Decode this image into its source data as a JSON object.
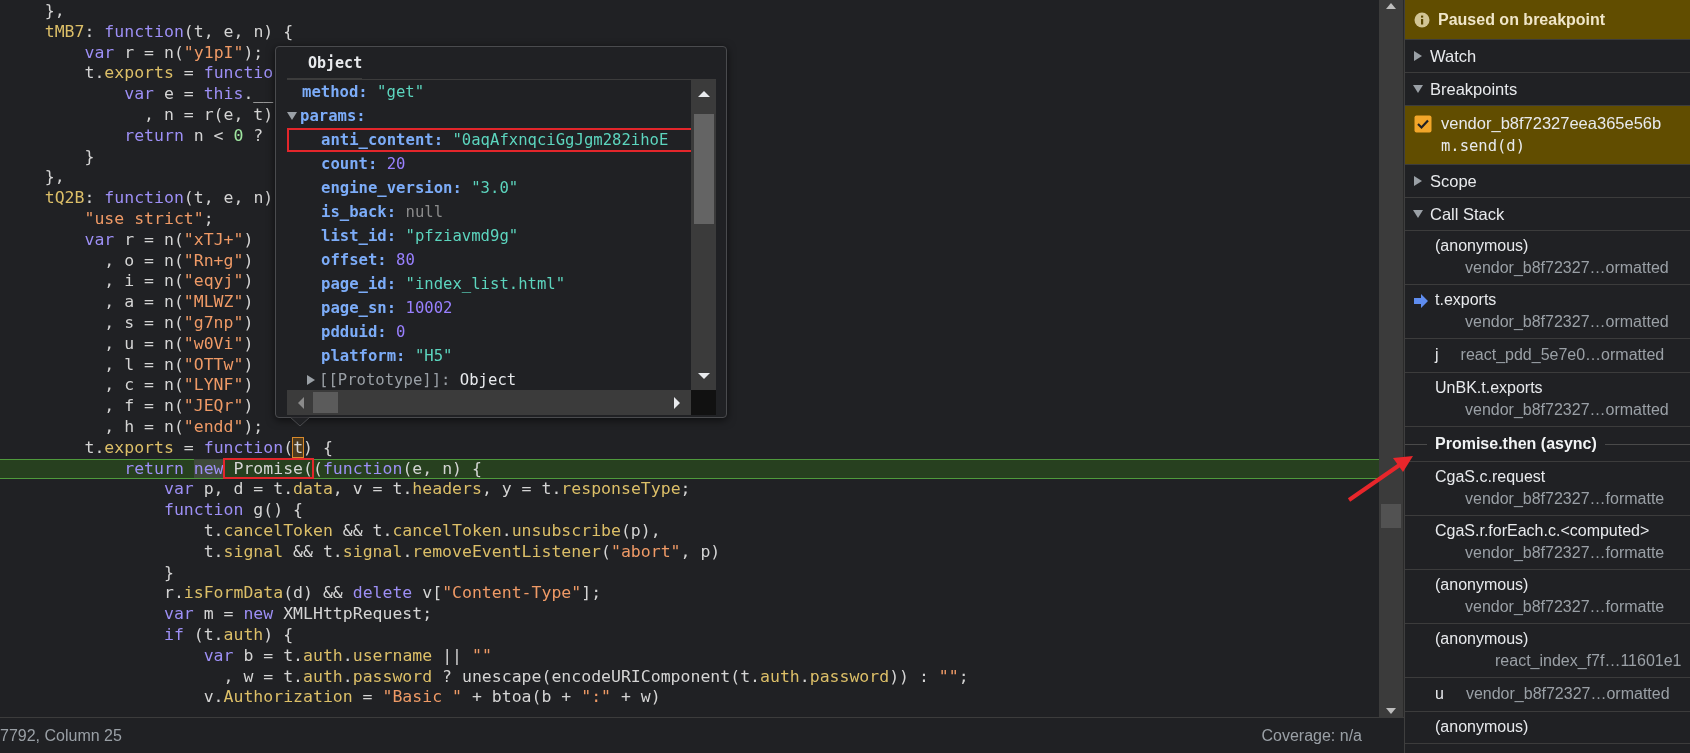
{
  "code": {
    "lines": [
      {
        "tokens": [
          {
            "kind": "plain",
            "text": "    },"
          }
        ]
      },
      {
        "tokens": [
          {
            "kind": "prop",
            "text": "    tMB7"
          },
          {
            "kind": "plain",
            "text": ": "
          },
          {
            "kind": "kw",
            "text": "function"
          },
          {
            "kind": "plain",
            "text": "(t, e, n) {"
          }
        ]
      },
      {
        "tokens": [
          {
            "kind": "kw",
            "text": "        var"
          },
          {
            "kind": "plain",
            "text": " r = n("
          },
          {
            "kind": "str",
            "text": "\"y1pI\""
          },
          {
            "kind": "plain",
            "text": ");"
          }
        ]
      },
      {
        "tokens": [
          {
            "kind": "plain",
            "text": "        t."
          },
          {
            "kind": "prop",
            "text": "exports"
          },
          {
            "kind": "plain",
            "text": " = "
          },
          {
            "kind": "kw",
            "text": "functio"
          }
        ]
      },
      {
        "tokens": [
          {
            "kind": "kw",
            "text": "            var"
          },
          {
            "kind": "plain",
            "text": " e = "
          },
          {
            "kind": "kw",
            "text": "this"
          },
          {
            "kind": "plain",
            "text": ".__"
          }
        ]
      },
      {
        "tokens": [
          {
            "kind": "plain",
            "text": "              , n = r(e, t)"
          }
        ]
      },
      {
        "tokens": [
          {
            "kind": "kw",
            "text": "            return"
          },
          {
            "kind": "plain",
            "text": " n < "
          },
          {
            "kind": "num",
            "text": "0"
          },
          {
            "kind": "plain",
            "text": " ?"
          }
        ]
      },
      {
        "tokens": [
          {
            "kind": "plain",
            "text": "        }"
          }
        ]
      },
      {
        "tokens": [
          {
            "kind": "plain",
            "text": "    },"
          }
        ]
      },
      {
        "tokens": [
          {
            "kind": "prop",
            "text": "    tQ2B"
          },
          {
            "kind": "plain",
            "text": ": "
          },
          {
            "kind": "kw",
            "text": "function"
          },
          {
            "kind": "plain",
            "text": "(t, e, n)"
          }
        ]
      },
      {
        "tokens": [
          {
            "kind": "str",
            "text": "        \"use strict\""
          },
          {
            "kind": "plain",
            "text": ";"
          }
        ]
      },
      {
        "tokens": [
          {
            "kind": "kw",
            "text": "        var"
          },
          {
            "kind": "plain",
            "text": " r = n("
          },
          {
            "kind": "str",
            "text": "\"xTJ+\""
          },
          {
            "kind": "plain",
            "text": ")"
          }
        ]
      },
      {
        "tokens": [
          {
            "kind": "plain",
            "text": "          , o = n("
          },
          {
            "kind": "str",
            "text": "\"Rn+g\""
          },
          {
            "kind": "plain",
            "text": ")"
          }
        ]
      },
      {
        "tokens": [
          {
            "kind": "plain",
            "text": "          , i = n("
          },
          {
            "kind": "str",
            "text": "\"eqyj\""
          },
          {
            "kind": "plain",
            "text": ")"
          }
        ]
      },
      {
        "tokens": [
          {
            "kind": "plain",
            "text": "          , a = n("
          },
          {
            "kind": "str",
            "text": "\"MLWZ\""
          },
          {
            "kind": "plain",
            "text": ")"
          }
        ]
      },
      {
        "tokens": [
          {
            "kind": "plain",
            "text": "          , s = n("
          },
          {
            "kind": "str",
            "text": "\"g7np\""
          },
          {
            "kind": "plain",
            "text": ")"
          }
        ]
      },
      {
        "tokens": [
          {
            "kind": "plain",
            "text": "          , u = n("
          },
          {
            "kind": "str",
            "text": "\"w0Vi\""
          },
          {
            "kind": "plain",
            "text": ")"
          }
        ]
      },
      {
        "tokens": [
          {
            "kind": "plain",
            "text": "          , l = n("
          },
          {
            "kind": "str",
            "text": "\"OTTw\""
          },
          {
            "kind": "plain",
            "text": ")"
          }
        ]
      },
      {
        "tokens": [
          {
            "kind": "plain",
            "text": "          , c = n("
          },
          {
            "kind": "str",
            "text": "\"LYNF\""
          },
          {
            "kind": "plain",
            "text": ")"
          }
        ]
      },
      {
        "tokens": [
          {
            "kind": "plain",
            "text": "          , f = n("
          },
          {
            "kind": "str",
            "text": "\"JEQr\""
          },
          {
            "kind": "plain",
            "text": ")"
          }
        ]
      },
      {
        "tokens": [
          {
            "kind": "plain",
            "text": "          , h = n("
          },
          {
            "kind": "str",
            "text": "\"endd\""
          },
          {
            "kind": "plain",
            "text": ");"
          }
        ]
      },
      {
        "tokens": [
          {
            "kind": "plain",
            "text": "        t."
          },
          {
            "kind": "prop",
            "text": "exports"
          },
          {
            "kind": "plain",
            "text": " = "
          },
          {
            "kind": "kw",
            "text": "function"
          },
          {
            "kind": "plain",
            "text": "("
          },
          {
            "kind": "plain",
            "text": "t",
            "cursor": true
          },
          {
            "kind": "plain",
            "text": ") {"
          }
        ]
      },
      {
        "paused": true,
        "tokens": [
          {
            "kind": "kw",
            "text": "            return "
          },
          {
            "kind": "kw",
            "text": "new",
            "highlighted": true
          },
          {
            "kind": "plain",
            "text": " Promise(",
            "annotated": true
          },
          {
            "kind": "plain",
            "text": "("
          },
          {
            "kind": "kw",
            "text": "function"
          },
          {
            "kind": "plain",
            "text": "(e, n) {"
          }
        ]
      },
      {
        "tokens": [
          {
            "kind": "kw",
            "text": "                var"
          },
          {
            "kind": "plain",
            "text": " p, d = t."
          },
          {
            "kind": "prop",
            "text": "data"
          },
          {
            "kind": "plain",
            "text": ", v = t."
          },
          {
            "kind": "prop",
            "text": "headers"
          },
          {
            "kind": "plain",
            "text": ", y = t."
          },
          {
            "kind": "prop",
            "text": "responseType"
          },
          {
            "kind": "plain",
            "text": ";"
          }
        ]
      },
      {
        "tokens": [
          {
            "kind": "kw",
            "text": "                function"
          },
          {
            "kind": "plain",
            "text": " g() {"
          }
        ]
      },
      {
        "tokens": [
          {
            "kind": "plain",
            "text": "                    t."
          },
          {
            "kind": "prop",
            "text": "cancelToken"
          },
          {
            "kind": "plain",
            "text": " && t."
          },
          {
            "kind": "prop",
            "text": "cancelToken"
          },
          {
            "kind": "plain",
            "text": "."
          },
          {
            "kind": "prop",
            "text": "unsubscribe"
          },
          {
            "kind": "plain",
            "text": "(p),"
          }
        ]
      },
      {
        "tokens": [
          {
            "kind": "plain",
            "text": "                    t."
          },
          {
            "kind": "prop",
            "text": "signal"
          },
          {
            "kind": "plain",
            "text": " && t."
          },
          {
            "kind": "prop",
            "text": "signal"
          },
          {
            "kind": "plain",
            "text": "."
          },
          {
            "kind": "prop",
            "text": "removeEventListener"
          },
          {
            "kind": "plain",
            "text": "("
          },
          {
            "kind": "str",
            "text": "\"abort\""
          },
          {
            "kind": "plain",
            "text": ", p)"
          }
        ]
      },
      {
        "tokens": [
          {
            "kind": "plain",
            "text": "                }"
          }
        ]
      },
      {
        "tokens": [
          {
            "kind": "plain",
            "text": "                r."
          },
          {
            "kind": "prop",
            "text": "isFormData"
          },
          {
            "kind": "plain",
            "text": "(d) && "
          },
          {
            "kind": "kw",
            "text": "delete"
          },
          {
            "kind": "plain",
            "text": " v["
          },
          {
            "kind": "str",
            "text": "\"Content-Type\""
          },
          {
            "kind": "plain",
            "text": "];"
          }
        ]
      },
      {
        "tokens": [
          {
            "kind": "kw",
            "text": "                var"
          },
          {
            "kind": "plain",
            "text": " m = "
          },
          {
            "kind": "kw",
            "text": "new"
          },
          {
            "kind": "plain",
            "text": " XMLHttpRequest;"
          }
        ]
      },
      {
        "tokens": [
          {
            "kind": "kw",
            "text": "                if"
          },
          {
            "kind": "plain",
            "text": " (t."
          },
          {
            "kind": "prop",
            "text": "auth"
          },
          {
            "kind": "plain",
            "text": ") {"
          }
        ]
      },
      {
        "tokens": [
          {
            "kind": "kw",
            "text": "                    var"
          },
          {
            "kind": "plain",
            "text": " b = t."
          },
          {
            "kind": "prop",
            "text": "auth"
          },
          {
            "kind": "plain",
            "text": "."
          },
          {
            "kind": "prop",
            "text": "username"
          },
          {
            "kind": "plain",
            "text": " || "
          },
          {
            "kind": "str",
            "text": "\"\""
          }
        ]
      },
      {
        "tokens": [
          {
            "kind": "plain",
            "text": "                      , w = t."
          },
          {
            "kind": "prop",
            "text": "auth"
          },
          {
            "kind": "plain",
            "text": "."
          },
          {
            "kind": "prop",
            "text": "password"
          },
          {
            "kind": "plain",
            "text": " ? unescape(encodeURIComponent(t."
          },
          {
            "kind": "prop",
            "text": "auth"
          },
          {
            "kind": "plain",
            "text": "."
          },
          {
            "kind": "prop",
            "text": "password"
          },
          {
            "kind": "plain",
            "text": ")) : "
          },
          {
            "kind": "str",
            "text": "\"\""
          },
          {
            "kind": "plain",
            "text": ";"
          }
        ]
      },
      {
        "tokens": [
          {
            "kind": "plain",
            "text": "                    v."
          },
          {
            "kind": "prop",
            "text": "Authorization"
          },
          {
            "kind": "plain",
            "text": " = "
          },
          {
            "kind": "str",
            "text": "\"Basic \""
          },
          {
            "kind": "plain",
            "text": " + btoa(b + "
          },
          {
            "kind": "str",
            "text": "\":\""
          },
          {
            "kind": "plain",
            "text": " + w)"
          }
        ]
      }
    ]
  },
  "tooltip": {
    "title": "Object",
    "properties": [
      {
        "key": "method:",
        "value": "\"get\"",
        "kind": "string"
      },
      {
        "key": "params:",
        "expanded": true,
        "children": [
          {
            "key": "anti_content:",
            "value": "\"0aqAfxnqciGgJgm282ihoE",
            "kind": "string",
            "annotated": true
          },
          {
            "key": "count:",
            "value": "20",
            "kind": "number"
          },
          {
            "key": "engine_version:",
            "value": "\"3.0\"",
            "kind": "string"
          },
          {
            "key": "is_back:",
            "value": "null",
            "kind": "null"
          },
          {
            "key": "list_id:",
            "value": "\"pfziavmd9g\"",
            "kind": "string"
          },
          {
            "key": "offset:",
            "value": "80",
            "kind": "number"
          },
          {
            "key": "page_id:",
            "value": "\"index_list.html\"",
            "kind": "string"
          },
          {
            "key": "page_sn:",
            "value": "10002",
            "kind": "number"
          },
          {
            "key": "pdduid:",
            "value": "0",
            "kind": "number"
          },
          {
            "key": "platform:",
            "value": "\"H5\"",
            "kind": "string"
          },
          {
            "key": "[[Prototype]]:",
            "value": "Object",
            "kind": "object",
            "internal": true,
            "expanded": false
          }
        ]
      }
    ]
  },
  "status_bar": {
    "position": "7792, Column 25",
    "coverage": "Coverage: n/a"
  },
  "debugger": {
    "banner": "Paused on breakpoint",
    "sections": [
      {
        "title": "Watch",
        "expanded": false
      },
      {
        "title": "Breakpoints",
        "expanded": true,
        "breakpoints": [
          {
            "file": "vendor_b8f72327eea365e56b",
            "code": "m.send(d)",
            "checked": true,
            "hit": true
          }
        ]
      },
      {
        "title": "Scope",
        "expanded": false
      },
      {
        "title": "Call Stack",
        "expanded": true,
        "frames": [
          {
            "kind": "stacked",
            "name": "(anonymous)",
            "location": "vendor_b8f72327…ormatted",
            "current": false
          },
          {
            "kind": "stacked",
            "name": "t.exports",
            "location": "vendor_b8f72327…ormatted",
            "current": true
          },
          {
            "kind": "inline",
            "name": "j",
            "location": "react_pdd_5e7e0…ormatted",
            "current": false
          },
          {
            "kind": "stacked",
            "name": "UnBK.t.exports",
            "location": "vendor_b8f72327…ormatted",
            "current": false
          },
          {
            "kind": "async",
            "name": "Promise.then (async)"
          },
          {
            "kind": "stacked",
            "name": "CgaS.c.request",
            "location": "vendor_b8f72327…formatte",
            "current": false
          },
          {
            "kind": "stacked",
            "name": "CgaS.r.forEach.c.<computed>",
            "location": "vendor_b8f72327…formatte",
            "current": false
          },
          {
            "kind": "stacked",
            "name": "(anonymous)",
            "location": "vendor_b8f72327…formatte",
            "current": false
          },
          {
            "kind": "stacked",
            "name": "(anonymous)",
            "location": "react_index_f7f…11601e1",
            "current": false
          },
          {
            "kind": "inline",
            "name": "u",
            "location": "vendor_b8f72327…ormatted",
            "current": false
          },
          {
            "kind": "stacked",
            "name": "(anonymous)",
            "current": false
          }
        ]
      }
    ]
  }
}
